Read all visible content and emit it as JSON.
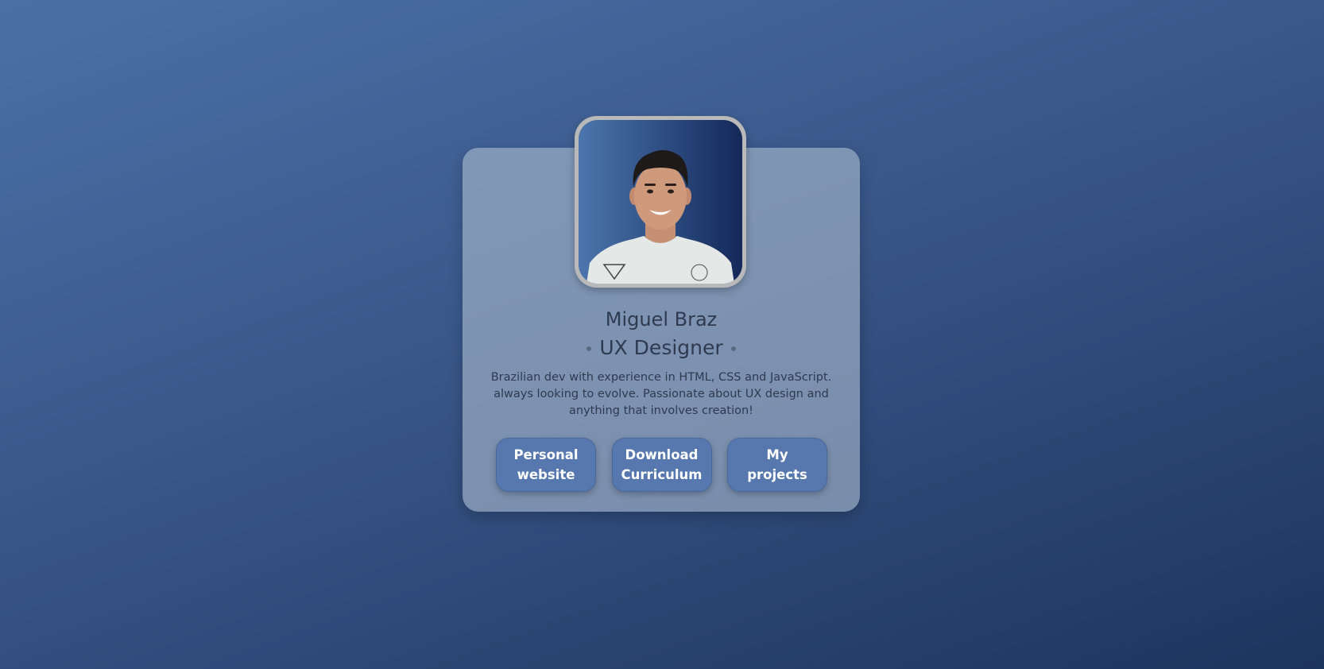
{
  "profile": {
    "name": "Miguel Braz",
    "role": "UX Designer",
    "bio": "Brazilian dev with experience in HTML, CSS and JavaScript. always looking to evolve. Passionate about UX design and anything that involves creation!"
  },
  "buttons": {
    "personal_website": "Personal website",
    "download_curriculum": "Download Curriculum",
    "my_projects": "My projects"
  },
  "colors": {
    "background_top": "#4b70a8",
    "background_bottom": "#1d345e",
    "button": "#5678ae",
    "text": "#2e3a50"
  }
}
